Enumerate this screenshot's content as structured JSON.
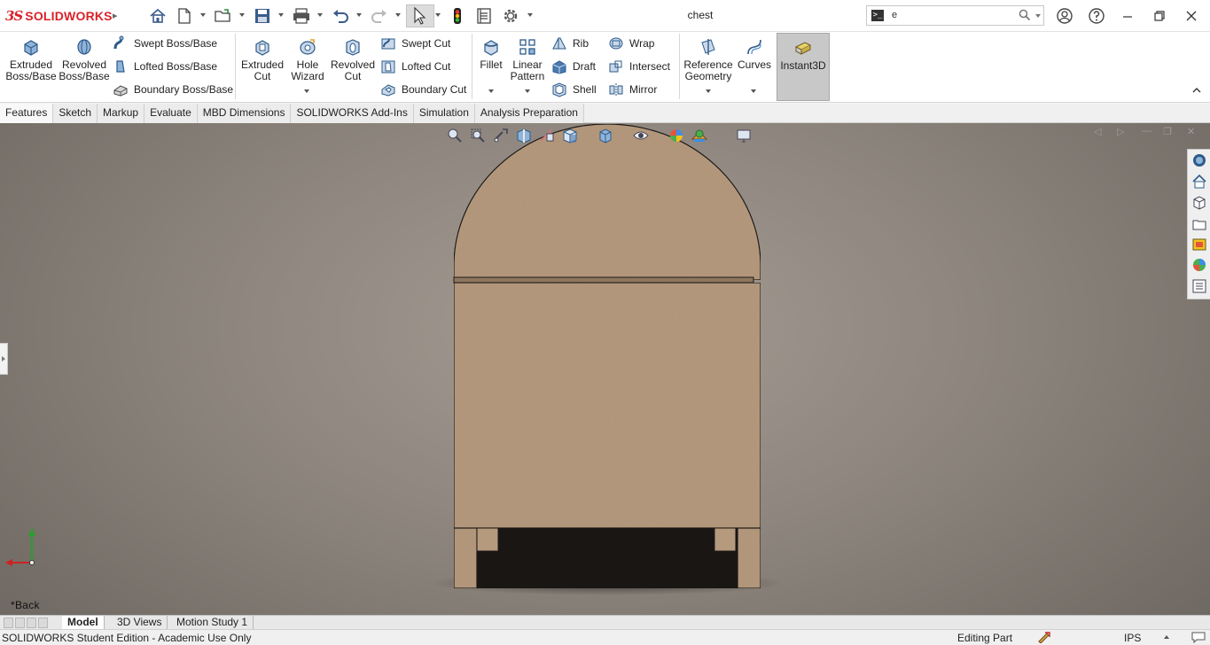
{
  "app": {
    "brand": "SOLIDWORKS",
    "document_title": "chest",
    "search": {
      "value": "e"
    }
  },
  "colors": {
    "brand_red": "#d9232a",
    "viewport_bg": "#8f877f",
    "wood": "#b69a7e",
    "selected_tool_bg": "#c8c8c8"
  },
  "quick_access": [
    "home-icon",
    "new-document-icon",
    "open-folder-icon",
    "save-icon",
    "print-icon",
    "undo-icon",
    "redo-icon",
    "select-arrow-icon",
    "rebuild-traffic-light-icon",
    "file-properties-icon",
    "options-gear-icon"
  ],
  "ribbon": {
    "extruded_boss": "Extruded Boss/Base",
    "revolved_boss": "Revolved Boss/Base",
    "swept_boss": "Swept Boss/Base",
    "lofted_boss": "Lofted Boss/Base",
    "boundary_boss": "Boundary Boss/Base",
    "extruded_cut": "Extruded Cut",
    "hole_wizard": "Hole Wizard",
    "revolved_cut": "Revolved Cut",
    "swept_cut": "Swept Cut",
    "lofted_cut": "Lofted Cut",
    "boundary_cut": "Boundary Cut",
    "fillet": "Fillet",
    "linear_pattern": "Linear Pattern",
    "rib": "Rib",
    "draft": "Draft",
    "shell": "Shell",
    "wrap": "Wrap",
    "intersect": "Intersect",
    "mirror": "Mirror",
    "reference_geometry": "Reference Geometry",
    "curves": "Curves",
    "instant3d": "Instant3D"
  },
  "tabs": [
    {
      "label": "Features",
      "active": true
    },
    {
      "label": "Sketch"
    },
    {
      "label": "Markup"
    },
    {
      "label": "Evaluate"
    },
    {
      "label": "MBD Dimensions"
    },
    {
      "label": "SOLIDWORKS Add-Ins"
    },
    {
      "label": "Simulation"
    },
    {
      "label": "Analysis Preparation"
    }
  ],
  "viewport": {
    "view_name": "*Back",
    "heads_up_toolbar": [
      "zoom-to-fit-icon",
      "zoom-to-area-icon",
      "previous-view-icon",
      "section-view-icon",
      "dynamic-annotation-icon",
      "view-orientation-icon",
      "display-style-icon",
      "hide-show-items-icon",
      "edit-appearance-icon",
      "apply-scene-icon",
      "view-settings-icon"
    ],
    "task_pane": [
      "solidworks-resources-icon",
      "design-library-icon",
      "file-explorer-icon",
      "view-palette-icon",
      "appearances-icon",
      "custom-properties-icon",
      "document-recovery-icon"
    ]
  },
  "bottom_tabs": [
    {
      "label": "Model",
      "active": true
    },
    {
      "label": "3D Views"
    },
    {
      "label": "Motion Study 1"
    }
  ],
  "status_bar": {
    "edition": "SOLIDWORKS Student Edition - Academic Use Only",
    "mode": "Editing Part",
    "units": "IPS"
  }
}
